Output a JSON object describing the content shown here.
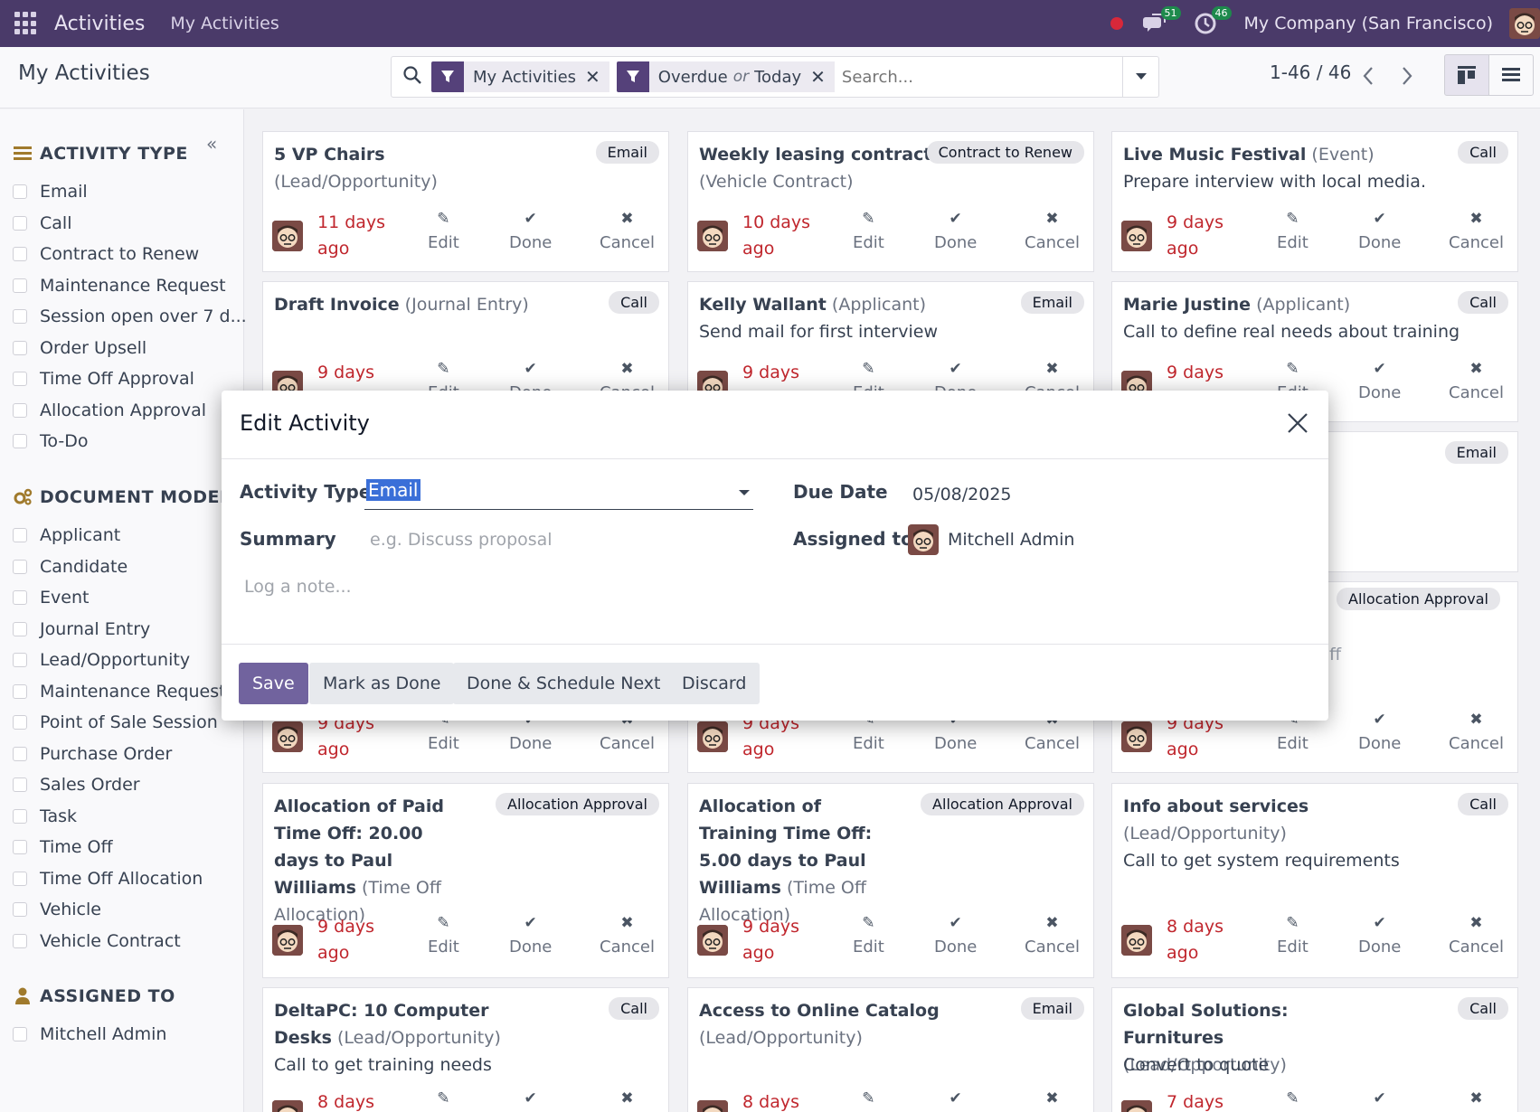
{
  "navbar": {
    "app_name": "Activities",
    "menu": "My Activities",
    "messages_count": "51",
    "activities_count": "46",
    "company": "My Company (San Francisco)"
  },
  "control_panel": {
    "breadcrumb": "My Activities",
    "facets": [
      {
        "label": "My Activities"
      },
      {
        "label_a": "Overdue",
        "or": "or",
        "label_b": "Today"
      }
    ],
    "search_placeholder": "Search...",
    "pager": "1-46 / 46"
  },
  "sidebar": {
    "activity_type_title": "ACTIVITY TYPE",
    "activity_types": [
      "Email",
      "Call",
      "Contract to Renew",
      "Maintenance Request",
      "Session open over 7 d...",
      "Order Upsell",
      "Time Off Approval",
      "Allocation Approval",
      "To-Do"
    ],
    "document_model_title": "DOCUMENT MODEL",
    "document_models": [
      "Applicant",
      "Candidate",
      "Event",
      "Journal Entry",
      "Lead/Opportunity",
      "Maintenance Request",
      "Point of Sale Session",
      "Purchase Order",
      "Sales Order",
      "Task",
      "Time Off",
      "Time Off Allocation",
      "Vehicle",
      "Vehicle Contract"
    ],
    "assigned_to_title": "ASSIGNED TO",
    "assigned_to": [
      "Mitchell Admin"
    ]
  },
  "actions": {
    "edit": "Edit",
    "done": "Done",
    "cancel": "Cancel"
  },
  "cards": [
    {
      "title": "5 VP Chairs",
      "model": "(Lead/Opportunity)",
      "tag": "Email",
      "summary": "",
      "due_a": "11 days",
      "due_b": "ago"
    },
    {
      "title": "Weekly leasing contract",
      "model": "(Vehicle Contract)",
      "tag": "Contract to Renew",
      "summary": "",
      "due_a": "10 days",
      "due_b": "ago"
    },
    {
      "title": "Live Music Festival",
      "model": "(Event)",
      "tag": "Call",
      "summary": "Prepare interview with local media.",
      "due_a": "9 days",
      "due_b": "ago"
    },
    {
      "title": "Draft Invoice",
      "model": "(Journal Entry)",
      "tag": "Call",
      "summary": "",
      "due_a": "9 days",
      "due_b": ""
    },
    {
      "title": "Kelly Wallant",
      "model": "(Applicant)",
      "tag": "Email",
      "summary": "Send mail for first interview",
      "due_a": "9 days",
      "due_b": ""
    },
    {
      "title": "Marie Justine",
      "model": "(Applicant)",
      "tag": "Call",
      "summary": "Call to define real needs about training",
      "due_a": "9 days",
      "due_b": ""
    },
    {
      "title": "",
      "model": "",
      "tag": "Email",
      "summary": "",
      "due_a": "",
      "due_b": ""
    },
    {
      "title": "",
      "model": "",
      "tag": "Allocation Approval",
      "summary": "ff",
      "due_a": "",
      "due_b": ""
    },
    {
      "title": "",
      "model": "",
      "tag": "",
      "summary": "",
      "due_a": "9 days",
      "due_b": "ago"
    },
    {
      "title": "",
      "model": "",
      "tag": "",
      "summary": "",
      "due_a": "9 days",
      "due_b": "ago"
    },
    {
      "title": "",
      "model": "",
      "tag": "",
      "summary": "",
      "due_a": "9 days",
      "due_b": "ago"
    },
    {
      "title": "Allocation of Paid Time Off: 20.00 days to Paul Williams",
      "model": "(Time Off Allocation)",
      "tag": "Allocation Approval",
      "summary": "",
      "due_a": "9 days",
      "due_b": "ago"
    },
    {
      "title": "Allocation of Training Time Off: 5.00 days to Paul Williams",
      "model": "(Time Off Allocation)",
      "tag": "Allocation Approval",
      "summary": "",
      "due_a": "9 days",
      "due_b": "ago"
    },
    {
      "title": "Info about services",
      "model": "(Lead/Opportunity)",
      "tag": "Call",
      "summary": "Call to get system requirements",
      "due_a": "8 days",
      "due_b": "ago"
    },
    {
      "title": "DeltaPC: 10 Computer Desks",
      "model": "(Lead/Opportunity)",
      "tag": "Call",
      "summary": "Call to get training needs",
      "due_a": "8 days",
      "due_b": ""
    },
    {
      "title": "Access to Online Catalog",
      "model": "(Lead/Opportunity)",
      "tag": "Email",
      "summary": "",
      "due_a": "8 days",
      "due_b": ""
    },
    {
      "title": "Global Solutions: Furnitures",
      "model": "(Lead/Opportunity)",
      "tag": "Call",
      "summary": "Convert to quote",
      "due_a": "7 days",
      "due_b": ""
    }
  ],
  "modal": {
    "title": "Edit Activity",
    "activity_type_label": "Activity Type",
    "activity_type_value": "Email",
    "summary_label": "Summary",
    "summary_placeholder": "e.g. Discuss proposal",
    "due_date_label": "Due Date",
    "due_date_value": "05/08/2025",
    "assigned_to_label": "Assigned to",
    "assigned_to_value": "Mitchell Admin",
    "note_placeholder": "Log a note...",
    "buttons": {
      "save": "Save",
      "mark_done": "Mark as Done",
      "done_schedule": "Done & Schedule Next",
      "discard": "Discard"
    }
  },
  "colors": {
    "navbar": "#4a3a69",
    "primary": "#71639e",
    "overdue": "#c0262d",
    "facet": "#55417a"
  }
}
